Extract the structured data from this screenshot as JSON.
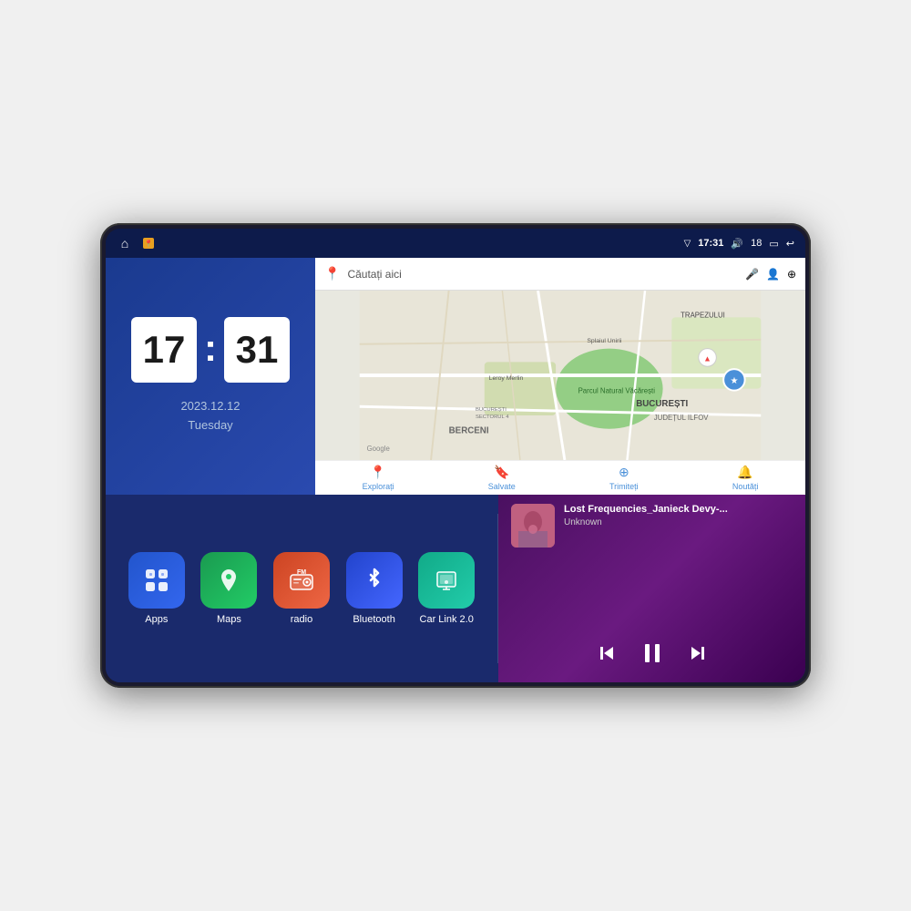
{
  "device": {
    "status_bar": {
      "left_icons": [
        "home-icon",
        "maps-nav-icon"
      ],
      "time": "17:31",
      "volume_icon": "🔊",
      "battery_level": "18",
      "window_icon": "▭",
      "back_icon": "↩"
    },
    "clock": {
      "hours": "17",
      "minutes": "31",
      "date": "2023.12.12",
      "day": "Tuesday"
    },
    "map": {
      "search_placeholder": "Căutați aici",
      "nav_items": [
        {
          "label": "Explorați",
          "icon": "📍"
        },
        {
          "label": "Salvate",
          "icon": "🔖"
        },
        {
          "label": "Trimiteți",
          "icon": "⊕"
        },
        {
          "label": "Noutăți",
          "icon": "🔔"
        }
      ],
      "labels": [
        "BERCENI",
        "BUCUREȘTI",
        "JUDEȚUL ILFOV",
        "TRAPEZULUI",
        "Parcul Natural Văcărești",
        "Leroy Merlin",
        "BUCUREȘTI SECTORUL 4",
        "Splaiul Unirii"
      ]
    },
    "apps": [
      {
        "id": "apps",
        "label": "Apps",
        "icon": "⊞",
        "color_class": "icon-apps"
      },
      {
        "id": "maps",
        "label": "Maps",
        "icon": "📍",
        "color_class": "icon-maps"
      },
      {
        "id": "radio",
        "label": "radio",
        "icon": "📻",
        "color_class": "icon-radio"
      },
      {
        "id": "bluetooth",
        "label": "Bluetooth",
        "icon": "✦",
        "color_class": "icon-bluetooth"
      },
      {
        "id": "carlink",
        "label": "Car Link 2.0",
        "icon": "📱",
        "color_class": "icon-carlink"
      }
    ],
    "music": {
      "title": "Lost Frequencies_Janieck Devy-...",
      "artist": "Unknown",
      "controls": {
        "prev": "⏮",
        "play": "⏸",
        "next": "⏭"
      }
    }
  }
}
